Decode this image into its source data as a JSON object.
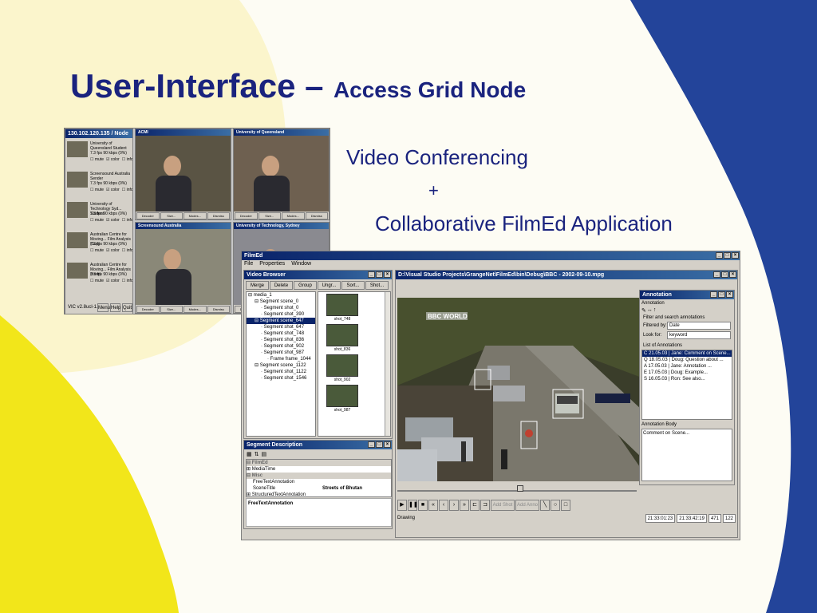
{
  "slide": {
    "title_main": "User-Interface –",
    "title_sub": "Access Grid Node",
    "bullet1": "Video Conferencing",
    "plus": "+",
    "bullet2": "Collaborative FilmEd Application"
  },
  "colors": {
    "navy": "#1a237e",
    "blue_shape": "#23449a",
    "yellow_shape": "#f2e61a",
    "cream_shape": "#fbf5cc"
  },
  "agn": {
    "sidebar_title": "130.102.120.135 / Node",
    "sites": [
      {
        "name": "University of Queensland Student",
        "stats": "7.3 fps   90 kbps   (0%)"
      },
      {
        "name": "Screensound Australia Sender",
        "stats": "7.3 fps   90 kbps   (0%)"
      },
      {
        "name": "University of Technology Syd... Student",
        "stats": "7.3 fps   90 kbps   (0%)"
      },
      {
        "name": "Australian Centre for Moving... Film Analysis (Sup)",
        "stats": "7.3 fps   90 kbps   (0%)"
      },
      {
        "name": "Australian Centre for Moving... Film Analysis (front)",
        "stats": "7.3 fps   90 kbps   (0%)"
      }
    ],
    "chk_mute": "mute",
    "chk_color": "color",
    "chk_info": "info",
    "version": "VIC v2.8ucl-1.0",
    "menu_btn": "Menu",
    "help_btn": "Help",
    "quit_btn": "Quit",
    "panels": [
      {
        "title": "ACMI"
      },
      {
        "title": "University of Queensland"
      },
      {
        "title": "Screensound Australia"
      },
      {
        "title": "University of Technology, Sydney"
      }
    ],
    "panel_btns": [
      "Decoder",
      "Size...",
      "Modes...",
      "Dismiss"
    ]
  },
  "filmed": {
    "title": "FilmEd",
    "menu": [
      "File",
      "Properties",
      "Window"
    ],
    "video_browser": {
      "title": "Video Browser",
      "buttons": [
        "Merge",
        "Delete",
        "Group",
        "Ungr...",
        "Sort...",
        "Shot..."
      ],
      "tree": [
        "media_1",
        "Segment scene_0",
        "Segment shot_0",
        "Segment shot_390",
        "Segment scene_647",
        "Segment shot_647",
        "Segment shot_748",
        "Segment shot_836",
        "Segment shot_902",
        "Segment shot_987",
        "Frame frame_1044",
        "Segment scene_1122",
        "Segment shot_1122",
        "Segment shot_1546"
      ],
      "thumbs": [
        "shot_748",
        "shot_836",
        "shot_902",
        "shot_987"
      ]
    },
    "segment": {
      "title": "Segment Description",
      "cat1": "FilmEd",
      "media_time": "MediaTime",
      "cat2": "Misc",
      "free_text": "FreeTextAnnotation",
      "scene_title": "SceneTitle",
      "scene_value": "Streets of Bhutan",
      "structured": "StructuredTextAnnotation",
      "footer": "FreeTextAnnotation"
    },
    "player": {
      "title": "D:\\Visual Studio Projects\\GrangeNet\\FilmEd\\bin\\Debug\\BBC - 2002-09-10.mpg",
      "logo": "BBC WORLD",
      "add_shot": "Add Shot",
      "add_anno": "Add Anno",
      "status_left": "Drawing",
      "time1": "21:33:01:23",
      "time2": "21:33:42:19",
      "frame1": "471",
      "frame2": "122"
    },
    "annotation": {
      "title": "Annotation",
      "menu": "Annotation",
      "filter_group": "Filter and search annotations",
      "filtered_by_label": "Filtered by:",
      "filtered_by_value": "Date",
      "look_for_label": "Look for:",
      "look_for_value": "keyword",
      "list_label": "List of Annotations",
      "items": [
        "C 21.05.03 | Jane: Comment on Scene...",
        "Q 18.05.03 | Doug: Question about ...",
        "A 17.05.03 | Jane: Annotation ...",
        "E 17.05.03 | Doug: Example...",
        "S 16.05.03 | Ron: See also..."
      ],
      "body_label": "Annotation Body",
      "body_text": "Comment on Scene..."
    }
  }
}
